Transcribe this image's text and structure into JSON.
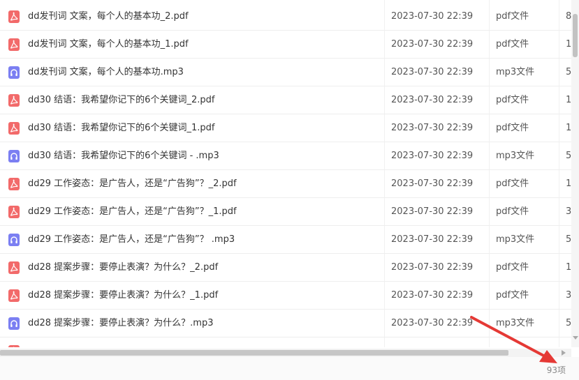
{
  "files": [
    {
      "name": "dd发刊词 文案，每个人的基本功_2.pdf",
      "modified": "2023-07-30 22:39",
      "type": "pdf文件",
      "size": "8",
      "icon": "pdf-file-icon"
    },
    {
      "name": "dd发刊词 文案，每个人的基本功_1.pdf",
      "modified": "2023-07-30 22:39",
      "type": "pdf文件",
      "size": "1",
      "icon": "pdf-file-icon"
    },
    {
      "name": "dd发刊词 文案，每个人的基本功.mp3",
      "modified": "2023-07-30 22:39",
      "type": "mp3文件",
      "size": "5",
      "icon": "audio-file-icon"
    },
    {
      "name": "dd30 结语：我希望你记下的6个关键词_2.pdf",
      "modified": "2023-07-30 22:39",
      "type": "pdf文件",
      "size": "1",
      "icon": "pdf-file-icon"
    },
    {
      "name": "dd30 结语：我希望你记下的6个关键词_1.pdf",
      "modified": "2023-07-30 22:39",
      "type": "pdf文件",
      "size": "1",
      "icon": "pdf-file-icon"
    },
    {
      "name": "dd30 结语：我希望你记下的6个关键词 -  .mp3",
      "modified": "2023-07-30 22:39",
      "type": "mp3文件",
      "size": "5",
      "icon": "audio-file-icon"
    },
    {
      "name": "dd29 工作姿态：是广告人，还是“广告狗”？_2.pdf",
      "modified": "2023-07-30 22:39",
      "type": "pdf文件",
      "size": "1",
      "icon": "pdf-file-icon"
    },
    {
      "name": "dd29 工作姿态：是广告人，还是“广告狗”？_1.pdf",
      "modified": "2023-07-30 22:39",
      "type": "pdf文件",
      "size": "3",
      "icon": "pdf-file-icon"
    },
    {
      "name": "dd29 工作姿态：是广告人，还是“广告狗”？ .mp3",
      "modified": "2023-07-30 22:39",
      "type": "mp3文件",
      "size": "5",
      "icon": "audio-file-icon"
    },
    {
      "name": "dd28 提案步骤：要停止表演？为什么？_2.pdf",
      "modified": "2023-07-30 22:39",
      "type": "pdf文件",
      "size": "1",
      "icon": "pdf-file-icon"
    },
    {
      "name": "dd28 提案步骤：要停止表演？为什么？_1.pdf",
      "modified": "2023-07-30 22:39",
      "type": "pdf文件",
      "size": "3",
      "icon": "pdf-file-icon"
    },
    {
      "name": "dd28 提案步骤：要停止表演？为什么？.mp3",
      "modified": "2023-07-30 22:39",
      "type": "mp3文件",
      "size": "5",
      "icon": "audio-file-icon"
    },
    {
      "name": "",
      "modified": "",
      "type": "",
      "size": "",
      "icon": "pdf-file-icon"
    }
  ],
  "status": {
    "item_count": "93项"
  },
  "colors": {
    "pdf": "#f26a6a",
    "mp3": "#7b7ff2",
    "annotation_arrow": "#e53935"
  }
}
